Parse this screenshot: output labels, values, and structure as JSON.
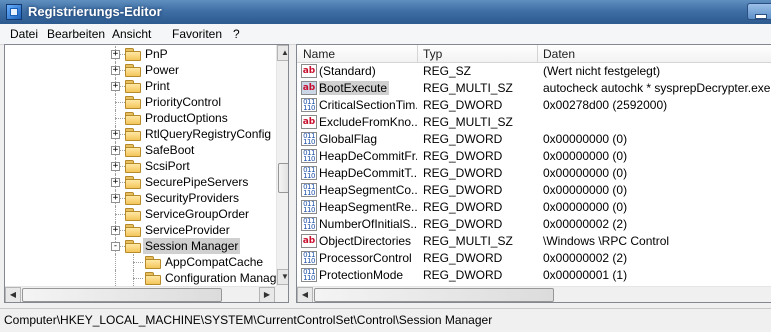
{
  "window": {
    "title": "Registrierungs-Editor"
  },
  "menu": [
    "Datei",
    "Bearbeiten",
    "Ansicht",
    "Favoriten",
    "?"
  ],
  "tree": {
    "items": [
      {
        "label": "PnP",
        "expander": "+",
        "level": 1
      },
      {
        "label": "Power",
        "expander": "+",
        "level": 1
      },
      {
        "label": "Print",
        "expander": "+",
        "level": 1
      },
      {
        "label": "PriorityControl",
        "expander": "",
        "level": 1
      },
      {
        "label": "ProductOptions",
        "expander": "",
        "level": 1
      },
      {
        "label": "RtlQueryRegistryConfig",
        "expander": "+",
        "level": 1
      },
      {
        "label": "SafeBoot",
        "expander": "+",
        "level": 1
      },
      {
        "label": "ScsiPort",
        "expander": "+",
        "level": 1
      },
      {
        "label": "SecurePipeServers",
        "expander": "+",
        "level": 1
      },
      {
        "label": "SecurityProviders",
        "expander": "+",
        "level": 1
      },
      {
        "label": "ServiceGroupOrder",
        "expander": "",
        "level": 1
      },
      {
        "label": "ServiceProvider",
        "expander": "+",
        "level": 1
      },
      {
        "label": "Session Manager",
        "expander": "-",
        "level": 1,
        "selected": true
      },
      {
        "label": "AppCompatCache",
        "expander": "",
        "level": 2
      },
      {
        "label": "Configuration Manager",
        "expander": "",
        "level": 2
      }
    ]
  },
  "list": {
    "columns": [
      "Name",
      "Typ",
      "Daten"
    ],
    "rows": [
      {
        "icon": "string-value-icon",
        "name": "(Standard)",
        "type": "REG_SZ",
        "data": "(Wert nicht festgelegt)"
      },
      {
        "icon": "string-value-icon",
        "name": "BootExecute",
        "type": "REG_MULTI_SZ",
        "data": "autocheck autochk * sysprepDecrypter.exe",
        "selected": true
      },
      {
        "icon": "binary-value-icon",
        "name": "CriticalSectionTim...",
        "type": "REG_DWORD",
        "data": "0x00278d00 (2592000)"
      },
      {
        "icon": "string-value-icon",
        "name": "ExcludeFromKno...",
        "type": "REG_MULTI_SZ",
        "data": ""
      },
      {
        "icon": "binary-value-icon",
        "name": "GlobalFlag",
        "type": "REG_DWORD",
        "data": "0x00000000 (0)"
      },
      {
        "icon": "binary-value-icon",
        "name": "HeapDeCommitFr...",
        "type": "REG_DWORD",
        "data": "0x00000000 (0)"
      },
      {
        "icon": "binary-value-icon",
        "name": "HeapDeCommitT...",
        "type": "REG_DWORD",
        "data": "0x00000000 (0)"
      },
      {
        "icon": "binary-value-icon",
        "name": "HeapSegmentCo...",
        "type": "REG_DWORD",
        "data": "0x00000000 (0)"
      },
      {
        "icon": "binary-value-icon",
        "name": "HeapSegmentRe...",
        "type": "REG_DWORD",
        "data": "0x00000000 (0)"
      },
      {
        "icon": "binary-value-icon",
        "name": "NumberOfInitialS...",
        "type": "REG_DWORD",
        "data": "0x00000002 (2)"
      },
      {
        "icon": "string-value-icon",
        "name": "ObjectDirectories",
        "type": "REG_MULTI_SZ",
        "data": "\\Windows \\RPC Control"
      },
      {
        "icon": "binary-value-icon",
        "name": "ProcessorControl",
        "type": "REG_DWORD",
        "data": "0x00000002 (2)"
      },
      {
        "icon": "binary-value-icon",
        "name": "ProtectionMode",
        "type": "REG_DWORD",
        "data": "0x00000001 (1)"
      }
    ]
  },
  "status": {
    "path": "Computer\\HKEY_LOCAL_MACHINE\\SYSTEM\\CurrentControlSet\\Control\\Session Manager"
  }
}
